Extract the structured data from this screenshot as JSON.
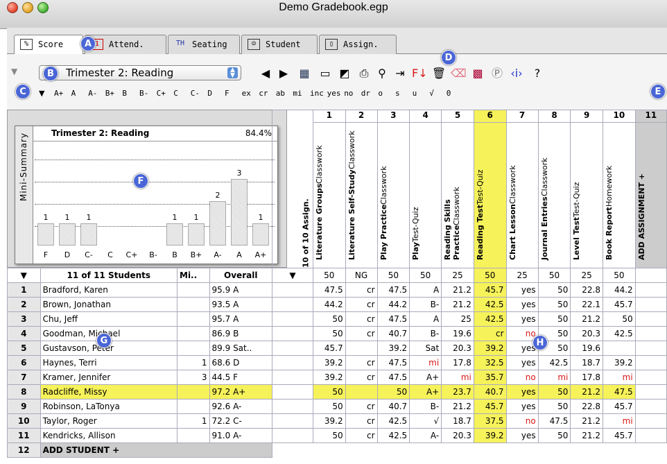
{
  "window": {
    "title": "Demo Gradebook.egp"
  },
  "tabs": [
    {
      "label": "Score",
      "icon": "score-icon"
    },
    {
      "label": "Attend.",
      "icon": "calendar-icon"
    },
    {
      "label": "Seating",
      "icon": "seating-icon"
    },
    {
      "label": "Student",
      "icon": "student-icon"
    },
    {
      "label": "Assign.",
      "icon": "assignment-icon"
    }
  ],
  "term": {
    "selected": "Trimester 2: Reading"
  },
  "callouts": [
    "A",
    "B",
    "C",
    "D",
    "E",
    "F",
    "G",
    "H"
  ],
  "grade_buttons": [
    "A+",
    "A",
    "A-",
    "B+",
    "B",
    "B-",
    "C+",
    "C",
    "C-",
    "D",
    "F",
    "ex",
    "cr",
    "ab",
    "mi",
    "inc",
    "yes",
    "no",
    "dr",
    "o",
    "s",
    "u",
    "√",
    "0"
  ],
  "mini_summary": {
    "side_label": "Mini-Summary",
    "title": "Trimester 2: Reading",
    "average": "84.4%"
  },
  "chart_data": {
    "type": "bar",
    "categories": [
      "F",
      "D",
      "C-",
      "C",
      "C+",
      "B-",
      "B",
      "B+",
      "A-",
      "A",
      "A+"
    ],
    "values": [
      1,
      1,
      1,
      0,
      0,
      0,
      1,
      1,
      2,
      3,
      1
    ],
    "value_labels": [
      "1",
      "1",
      "1",
      "",
      "",
      "",
      "1",
      "1",
      "2",
      "3",
      "1"
    ],
    "title": "Trimester 2: Reading",
    "xlabel": "",
    "ylabel": "",
    "ylim": [
      0,
      3.5
    ]
  },
  "assignments_header": {
    "count_label": "10 of 10 Assign.",
    "add_label": "ADD ASSIGNMENT +"
  },
  "assignments": [
    {
      "num": "1",
      "name": "Literature Groups",
      "cat": "Classwork",
      "pts": "50"
    },
    {
      "num": "2",
      "name": "Literature Self-Study",
      "cat": "Classwork",
      "pts": "NG"
    },
    {
      "num": "3",
      "name": "Play Practice",
      "cat": "Classwork",
      "pts": "50"
    },
    {
      "num": "4",
      "name": "Play",
      "cat": "Test-Quiz",
      "pts": "50"
    },
    {
      "num": "5",
      "name": "Reading Skills Practice",
      "cat": "Classwork",
      "pts": "25"
    },
    {
      "num": "6",
      "name": "Reading Test",
      "cat": "Test-Quiz",
      "pts": "50"
    },
    {
      "num": "7",
      "name": "Chart Lesson",
      "cat": "Classwork",
      "pts": "25"
    },
    {
      "num": "8",
      "name": "Journal Entries",
      "cat": "Classwork",
      "pts": "50"
    },
    {
      "num": "9",
      "name": "Level Test",
      "cat": "Test-Quiz",
      "pts": "25"
    },
    {
      "num": "10",
      "name": "Book Report",
      "cat": "Homework",
      "pts": "50"
    },
    {
      "num": "11",
      "name": "",
      "cat": "",
      "pts": ""
    }
  ],
  "students_header": {
    "count": "11 of 11 Students",
    "missing": "Mi..",
    "overall": "Overall"
  },
  "students": [
    {
      "n": "1",
      "name": "Bradford, Karen",
      "mi": "",
      "ov": "95.9 A",
      "scores": [
        "47.5",
        "cr",
        "47.5",
        "A",
        "21.2",
        "45.7",
        "yes",
        "50",
        "22.8",
        "44.2"
      ]
    },
    {
      "n": "2",
      "name": "Brown, Jonathan",
      "mi": "",
      "ov": "93.5 A",
      "scores": [
        "44.2",
        "cr",
        "44.2",
        "B-",
        "21.2",
        "42.5",
        "yes",
        "50",
        "22.1",
        "45.7"
      ]
    },
    {
      "n": "3",
      "name": "Chu, Jeff",
      "mi": "",
      "ov": "95.7 A",
      "scores": [
        "50",
        "cr",
        "47.5",
        "A",
        "25",
        "42.5",
        "yes",
        "50",
        "21.2",
        "50"
      ]
    },
    {
      "n": "4",
      "name": "Goodman, Michael",
      "mi": "",
      "ov": "86.9 B",
      "scores": [
        "50",
        "cr",
        "40.7",
        "B-",
        "19.6",
        "cr",
        "no",
        "50",
        "20.3",
        "42.5"
      ]
    },
    {
      "n": "5",
      "name": "Gustavson, Peter",
      "mi": "",
      "ov": "89.9 Sat..",
      "scores": [
        "45.7",
        "",
        "39.2",
        "Sat",
        "20.3",
        "39.2",
        "yes",
        "50",
        "19.6",
        ""
      ]
    },
    {
      "n": "6",
      "name": "Haynes, Terri",
      "mi": "1",
      "ov": "68.6 D",
      "scores": [
        "39.2",
        "cr",
        "47.5",
        "mi",
        "17.8",
        "32.5",
        "yes",
        "42.5",
        "18.7",
        "39.2"
      ]
    },
    {
      "n": "7",
      "name": "Kramer, Jennifer",
      "mi": "3",
      "ov": "44.5 F",
      "scores": [
        "39.2",
        "cr",
        "47.5",
        "A+",
        "mi",
        "35.7",
        "no",
        "mi",
        "17.8",
        "mi"
      ]
    },
    {
      "n": "8",
      "name": "Radcliffe, Missy",
      "mi": "",
      "ov": "97.2 A+",
      "scores": [
        "50",
        "",
        "50",
        "A+",
        "23.7",
        "40.7",
        "yes",
        "50",
        "21.2",
        "47.5"
      ]
    },
    {
      "n": "9",
      "name": "Robinson, LaTonya",
      "mi": "",
      "ov": "92.6 A-",
      "scores": [
        "50",
        "cr",
        "40.7",
        "B-",
        "21.2",
        "45.7",
        "yes",
        "50",
        "22.8",
        "45.7"
      ]
    },
    {
      "n": "10",
      "name": "Taylor, Roger",
      "mi": "1",
      "ov": "72.2 C-",
      "scores": [
        "39.2",
        "cr",
        "42.5",
        "√",
        "18.7",
        "37.5",
        "no",
        "47.5",
        "21.2",
        "mi"
      ]
    },
    {
      "n": "11",
      "name": "Kendricks, Allison",
      "mi": "",
      "ov": "91.0 A-",
      "scores": [
        "50",
        "cr",
        "42.5",
        "A-",
        "20.3",
        "39.2",
        "yes",
        "50",
        "21.2",
        "45.7"
      ]
    }
  ],
  "add_student": {
    "n": "12",
    "label": "ADD STUDENT +"
  },
  "colors": {
    "highlight": "#f6f25a",
    "accent": "#4a66d6",
    "red": "#d81818"
  }
}
